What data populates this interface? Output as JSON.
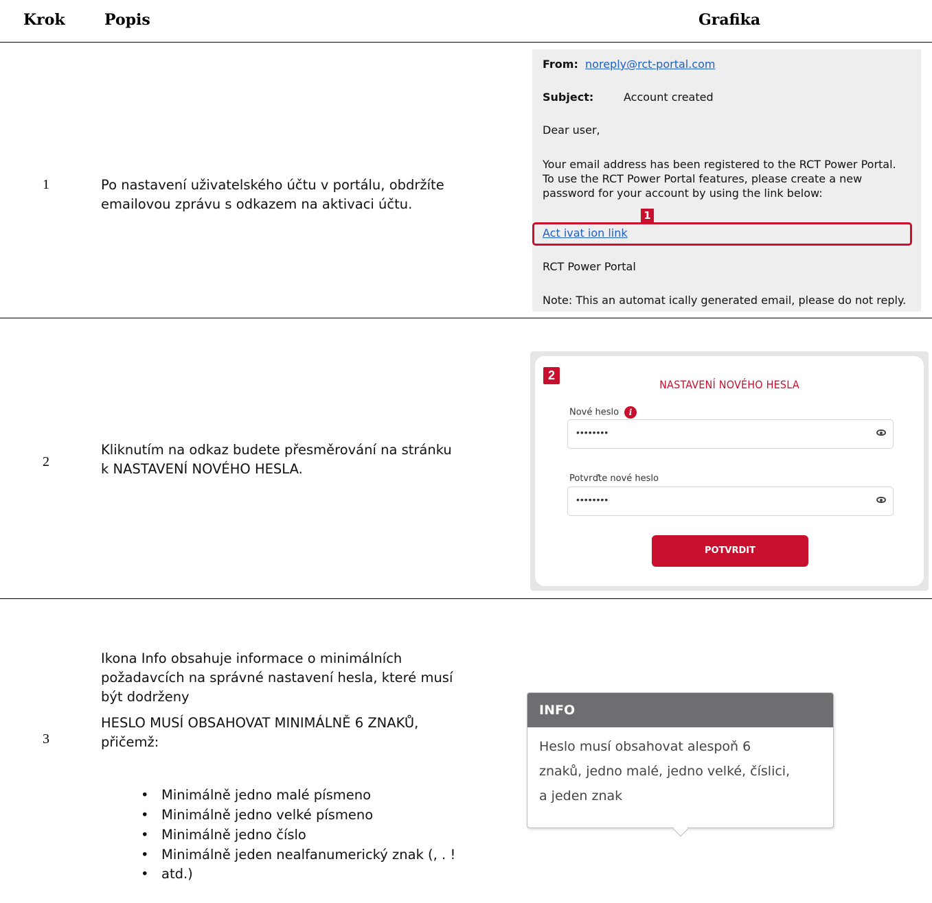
{
  "header": {
    "col_step": "Krok",
    "col_desc": "Popis",
    "col_graphic": "Grafika"
  },
  "step1": {
    "number": "1",
    "desc_line1": "Po nastavení uživatelského účtu v portálu, obdržíte",
    "desc_line2": "emailovou zprávu s odkazem na aktivaci účtu.",
    "email": {
      "from_label": "From:",
      "from_value": "noreply@rct-portal.com",
      "subject_label": "Subject:",
      "subject_value": "Account created",
      "greeting": "Dear user,",
      "body_line1": "Your email address has been registered to the RCT Power Portal.",
      "body_line2": "To use the RCT Power Portal features, please create a new",
      "body_line3": "password for your account by using the link below:",
      "link": "Act ivat ion link",
      "highlight_tag": "1",
      "signature": "RCT Power Portal",
      "note": "Note: This an automat ically generated email, please do not reply."
    }
  },
  "step2": {
    "number": "2",
    "desc_line1": "Kliknutím na odkaz budete přesměrování na stránku",
    "desc_line2": "k NASTAVENÍ NOVÉHO HESLA.",
    "form": {
      "tag": "2",
      "title": "NASTAVENÍ NOVÉHO HESLA",
      "new_password_label": "Nové heslo",
      "info_icon": "i",
      "new_password_value": "••••••••",
      "confirm_label": "Potvrďte nové heslo",
      "confirm_value": "••••••••",
      "submit_label": "POTVRDIT"
    }
  },
  "step3": {
    "number": "3",
    "desc_line1": "Ikona Info obsahuje informace o minimálních",
    "desc_line2": "požadavcích na správné nastavení hesla, které musí",
    "desc_line3": "být dodrženy",
    "rule_line1": "HESLO MUSÍ OBSAHOVAT MINIMÁLNĚ 6 ZNAKŮ,",
    "rule_line2": "přičemž:",
    "bullets": [
      "Minimálně jedno malé písmeno",
      "Minimálně jedno velké písmeno",
      "Minimálně jedno číslo",
      "Minimálně jeden nealfanumerický znak (, . !",
      "atd.)"
    ],
    "info": {
      "title": "INFO",
      "line1": "Heslo musí obsahovat alespoň 6",
      "line2": "znaků, jedno malé, jedno velké, číslici,",
      "line3": "a jeden znak"
    }
  }
}
